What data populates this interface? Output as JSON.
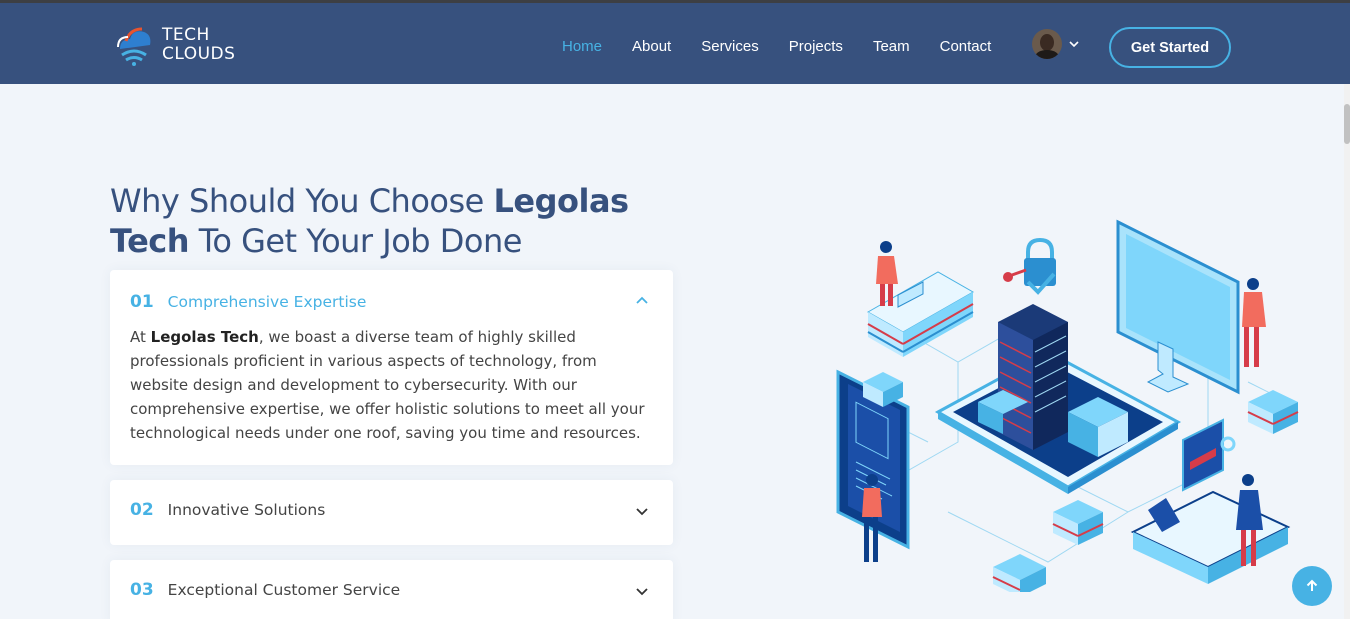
{
  "header": {
    "logo_line1": "TECH",
    "logo_line2": "CLOUDS",
    "nav": [
      {
        "label": "Home",
        "active": true
      },
      {
        "label": "About"
      },
      {
        "label": "Services"
      },
      {
        "label": "Projects"
      },
      {
        "label": "Team"
      },
      {
        "label": "Contact"
      }
    ],
    "cta_label": "Get Started"
  },
  "section": {
    "heading_part1": "Why Should You Choose ",
    "heading_bold": "Legolas Tech",
    "heading_part2": " To Get Your Job Done"
  },
  "accordion": [
    {
      "num": "01",
      "title": "Comprehensive Expertise",
      "expanded": true,
      "body_prefix": "At ",
      "body_bold": "Legolas Tech",
      "body_rest": ", we boast a diverse team of highly skilled professionals proficient in various aspects of technology, from website design and development to cybersecurity. With our comprehensive expertise, we offer holistic solutions to meet all your technological needs under one roof, saving you time and resources."
    },
    {
      "num": "02",
      "title": "Innovative Solutions",
      "expanded": false
    },
    {
      "num": "03",
      "title": "Exceptional Customer Service",
      "expanded": false
    }
  ],
  "colors": {
    "header_bg": "#37517e",
    "accent": "#47b2e4",
    "page_bg": "#f1f5fa"
  },
  "icons": {
    "avatar_dropdown": "chevron-down-icon",
    "accordion_open": "chevron-up-icon",
    "accordion_closed": "chevron-down-icon",
    "back_to_top": "arrow-up-icon"
  }
}
